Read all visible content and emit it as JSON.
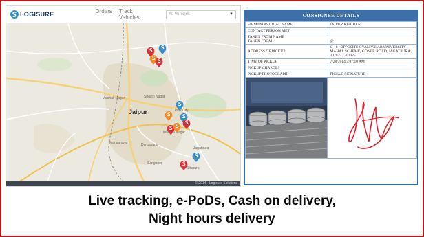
{
  "app": {
    "brand": "LOGISURE",
    "nav": [
      "Orders",
      "Track Vehicles"
    ],
    "select_value": "All Vehicles",
    "footer": "© 2014 · Logisure Solutions"
  },
  "map_labels": [
    "Jaipur",
    "Shastri Nagar",
    "Pink City",
    "Malviya Nagar",
    "Sanganer",
    "Vaishali Nagar",
    "Mansarovar",
    "Jagatpura",
    "Sitapura",
    "Durgapura"
  ],
  "consignee": {
    "title": "CONSIGNEE DETAILS",
    "rows": [
      {
        "k": "FIRM/INDIVIDUAL NAME",
        "v": "JAIPUR KITCHEN"
      },
      {
        "k": "CONTACT PERSON MET",
        "v": ""
      },
      {
        "k": "TAKEN FROM NAME",
        "v": ""
      },
      {
        "k": "TAKEN FROM",
        "v": "@"
      },
      {
        "k": "ADDRESS OF PICKUP",
        "v": "C - 6 , OPPOSITE GYAN VIHAR UNIVERSITY , MAHAL SCHEME, GONER ROAD, JAGATPURA , 302025 , 302025"
      },
      {
        "k": "TIME OF PICKUP",
        "v": "7/28/2014 7:07:10 AM"
      },
      {
        "k": "PICKUP CHARGES",
        "v": ""
      },
      {
        "k": "PICKUP PHOTOGRAPH",
        "v": "PICKUP SIGNATURE"
      }
    ]
  },
  "caption": {
    "line1": "Live tracking, e-PoDs, Cash on delivery,",
    "line2": "Night hours delivery"
  },
  "colors": {
    "frame": "#b01c1c",
    "card_header": "#3d6fa8",
    "marker_red": "#d9323a",
    "marker_orange": "#f28c28",
    "marker_blue": "#3a8fc8",
    "signature": "#e01e2a"
  }
}
